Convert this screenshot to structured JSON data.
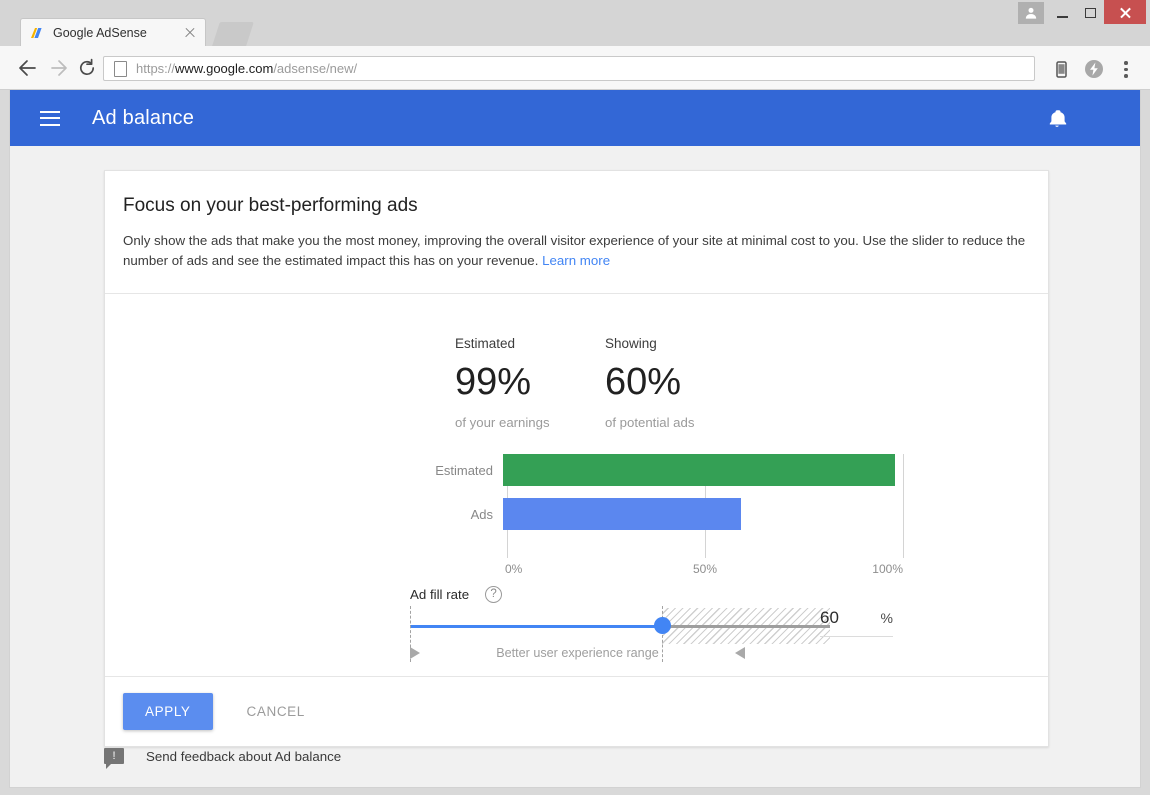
{
  "browser": {
    "tab": {
      "title": "Google AdSense",
      "favicon_icon": "adsense-logo-icon",
      "close_icon": "close-icon"
    },
    "new_tab_icon": "new-tab-stub",
    "window_controls": {
      "profile_icon": "person-icon",
      "minimize_icon": "minimize-icon",
      "maximize_icon": "maximize-icon",
      "close_icon": "window-close-icon"
    },
    "toolbar": {
      "back_icon": "back-arrow-icon",
      "forward_icon": "forward-arrow-icon",
      "reload_icon": "reload-icon",
      "page_info_icon": "document-icon",
      "url_prefix": "https://",
      "url_host": "www.google.com",
      "url_path": "/adsense/new/",
      "url_full": "https://www.google.com/adsense/new/",
      "mobile_icon": "mobile-device-icon",
      "flash_icon": "flash-lightning-icon",
      "menu_icon": "three-dot-menu-icon"
    }
  },
  "app": {
    "menu_icon": "hamburger-menu-icon",
    "title": "Ad balance",
    "notifications_icon": "bell-icon",
    "header_color": "#3367d6"
  },
  "card": {
    "title": "Focus on your best-performing ads",
    "description": "Only show the ads that make you the most money, improving the overall visitor experience of your site at minimal cost to you. Use the slider to reduce the number of ads and see the estimated impact this has on your revenue.",
    "learn_more": "Learn more",
    "stats": [
      {
        "label": "Estimated",
        "value": "99%",
        "sub": "of your earnings"
      },
      {
        "label": "Showing",
        "value": "60%",
        "sub": "of potential ads"
      }
    ],
    "slider": {
      "label": "Ad fill rate",
      "help_icon": "help-circle-icon",
      "value": 60,
      "value_text": "60",
      "unit": "%",
      "min": 0,
      "max": 100,
      "better_range_text": "Better user experience range",
      "range_start_marker_icon": "triangle-right-icon",
      "range_end_marker_icon": "triangle-left-icon",
      "track_color": "#4285f4",
      "thumb_color": "#4285f4"
    },
    "actions": {
      "apply_label": "APPLY",
      "cancel_label": "CANCEL",
      "apply_color": "#5b8def"
    }
  },
  "feedback": {
    "icon": "feedback-bubble-icon",
    "icon_glyph": "!",
    "text": "Send feedback about Ad balance"
  },
  "chart_data": {
    "type": "bar",
    "orientation": "horizontal",
    "title": "",
    "categories": [
      "Estimated",
      "Ads"
    ],
    "values": [
      99,
      60
    ],
    "colors": [
      "#34a055",
      "#5b87ef"
    ],
    "xlabel": "",
    "ylabel": "",
    "xlim": [
      0,
      100
    ],
    "tick_labels": [
      "0%",
      "50%",
      "100%"
    ],
    "tick_values": [
      0,
      50,
      100
    ],
    "grid": true,
    "legend": false,
    "series": [
      {
        "name": "Estimated",
        "value": 99,
        "color": "#34a055"
      },
      {
        "name": "Ads",
        "value": 60,
        "color": "#5b87ef"
      }
    ]
  }
}
